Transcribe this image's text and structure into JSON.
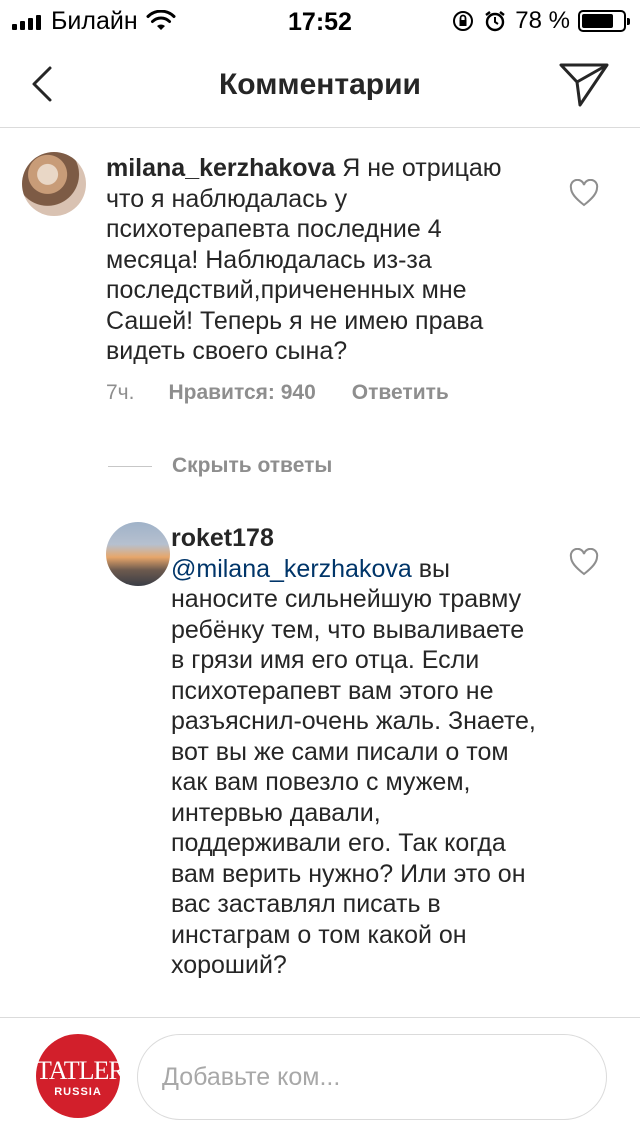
{
  "status_bar": {
    "carrier": "Билайн",
    "time": "17:52",
    "battery_percent": "78 %",
    "battery_level": 0.78
  },
  "nav": {
    "title": "Комментарии"
  },
  "comment": {
    "username": "milana_kerzhakova",
    "text": " Я не отрицаю что я наблюдалась у психотерапевта последние 4 месяца! Наблюдалась из-за последствий,причененных мне Сашей! Теперь я не имею права видеть своего сына?",
    "time": "7ч.",
    "likes_label": "Нравится: 940",
    "reply_label": "Ответить"
  },
  "hide_replies_label": "Скрыть ответы",
  "reply": {
    "username": "roket178",
    "mention": "@milana_kerzhakova",
    "text": " вы наносите сильнейшую травму ребёнку тем, что вываливаете в грязи имя его отца. Если психотерапевт вам этого не разъяснил-очень жаль. Знаете, вот вы же сами писали о том как вам повезло с мужем, интервью давали, поддерживали его. Так когда вам верить нужно? Или это он вас заставлял писать в инстаграм о том какой он хороший?"
  },
  "composer": {
    "brand_top": "TATLER",
    "brand_bottom": "RUSSIA",
    "placeholder": "Добавьте ком..."
  },
  "icons": {
    "back": "chevron-left-icon",
    "send": "paper-plane-icon",
    "like": "heart-outline-icon",
    "wifi": "wifi-icon",
    "lock": "rotation-lock-icon",
    "alarm": "alarm-icon",
    "battery": "battery-icon"
  },
  "colors": {
    "mention": "#003569",
    "secondary_text": "#8e8e8e",
    "brand": "#d21f2b"
  }
}
